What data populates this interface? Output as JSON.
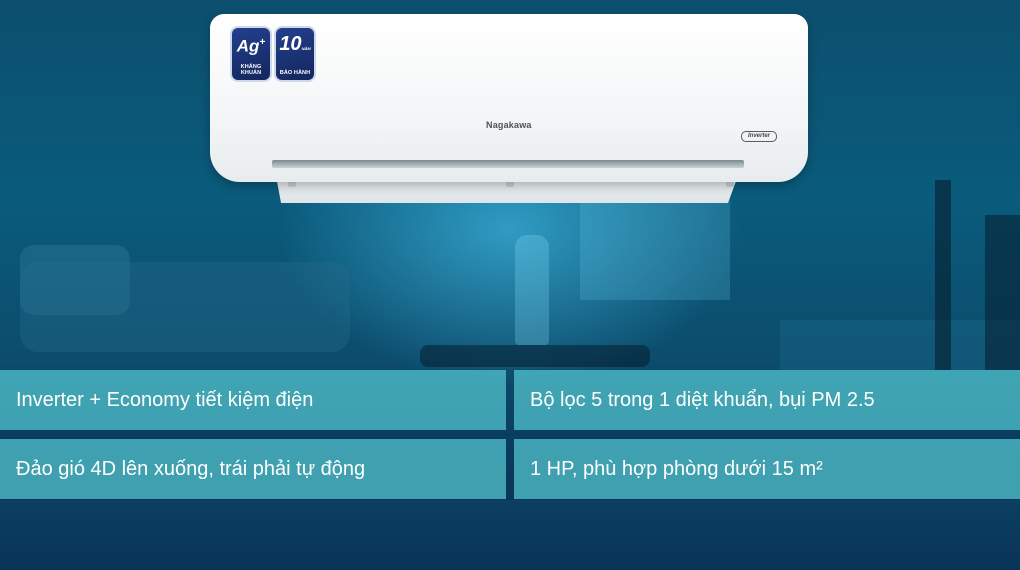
{
  "product": {
    "brand": "Nagakawa",
    "inverter_label": "Inverter",
    "badge_antibacterial": {
      "main": "Ag",
      "sup": "+",
      "caption": "KHÁNG KHUẨN"
    },
    "badge_warranty": {
      "main": "10",
      "unit": "NĂM",
      "caption": "BẢO HÀNH"
    }
  },
  "features": [
    "Inverter + Economy tiết kiệm điện",
    "Bộ lọc 5 trong 1 diệt khuẩn, bụi PM 2.5",
    "Đảo gió 4D lên xuống, trái phải tự động",
    "1 HP, phù hợp phòng dưới 15 m²"
  ],
  "colors": {
    "tile": "#4ebec8",
    "background": "#0b3556",
    "text": "#ffffff"
  }
}
